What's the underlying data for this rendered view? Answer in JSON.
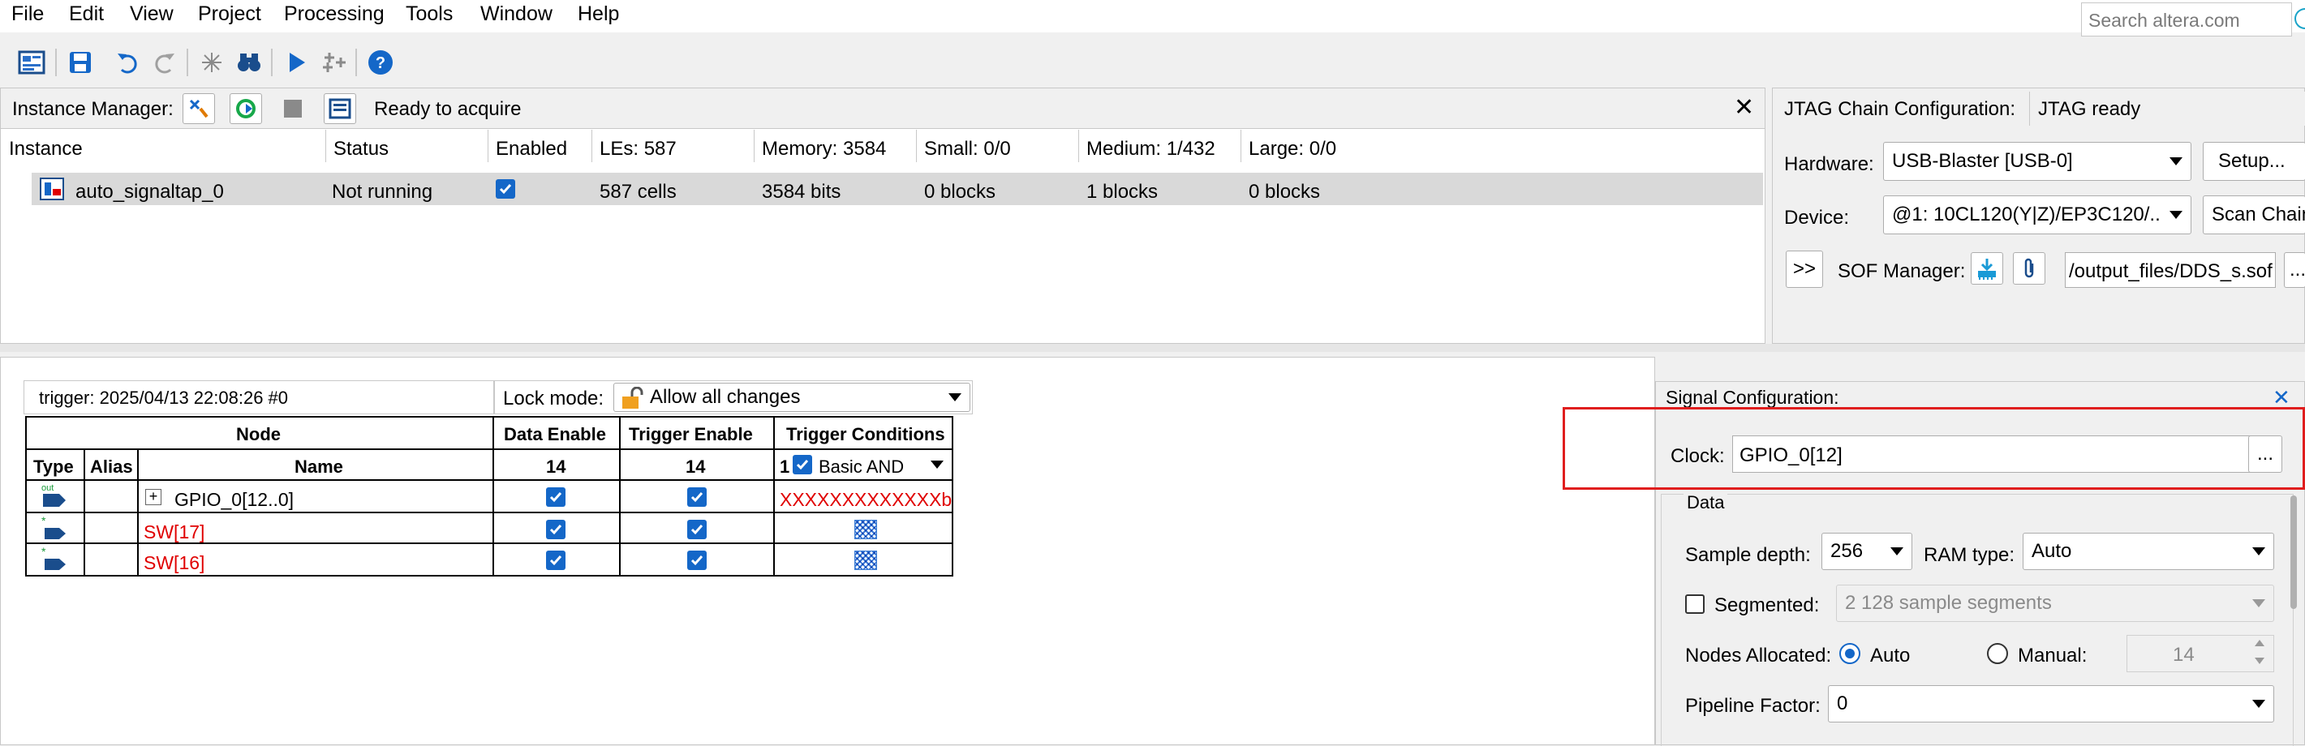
{
  "menu": {
    "items": [
      "File",
      "Edit",
      "View",
      "Project",
      "Processing",
      "Tools",
      "Window",
      "Help"
    ],
    "search_placeholder": "Search altera.com"
  },
  "toolbar": {
    "icons": [
      "signaltap-icon",
      "save-icon",
      "undo-icon",
      "redo-icon",
      "autorun-icon",
      "find-icon",
      "run-icon",
      "stop-analysis-icon",
      "help-icon"
    ]
  },
  "instance_manager": {
    "label": "Instance Manager:",
    "status": "Ready to acquire",
    "columns": [
      "Instance",
      "Status",
      "Enabled",
      "LEs: 587",
      "Memory: 3584",
      "Small: 0/0",
      "Medium: 1/432",
      "Large: 0/0"
    ],
    "row": {
      "instance": "auto_signaltap_0",
      "status": "Not running",
      "enabled": true,
      "les": "587 cells",
      "memory": "3584 bits",
      "small": "0 blocks",
      "medium": "1 blocks",
      "large": "0 blocks"
    }
  },
  "jtag": {
    "label": "JTAG Chain Configuration:",
    "status": "JTAG ready",
    "hardware_label": "Hardware:",
    "hardware_value": "USB-Blaster [USB-0]",
    "setup_button": "Setup...",
    "device_label": "Device:",
    "device_value": "@1: 10CL120(Y|Z)/EP3C120/..",
    "scan_chain_button": "Scan Chain",
    "expand_button": ">>",
    "sof_label": "SOF Manager:",
    "sof_value": "/output_files/DDS_s.sof",
    "browse_button": "..."
  },
  "signal_panel": {
    "trigger_label": "trigger: 2025/04/13 22:08:26  #0",
    "lock_mode_label": "Lock mode:",
    "lock_mode_value": "Allow all changes",
    "headers": {
      "node": "Node",
      "data_enable": "Data Enable",
      "trigger_enable": "Trigger Enable",
      "trigger_conditions": "Trigger Conditions",
      "type": "Type",
      "alias": "Alias",
      "name": "Name",
      "data_enable_count": "14",
      "trigger_enable_count": "14",
      "trigger_cond_prefix": "1",
      "trigger_cond_value": "Basic AND"
    },
    "rows": [
      {
        "name": "GPIO_0[12..0]",
        "trigger": "XXXXXXXXXXXXXb",
        "expand": "+"
      },
      {
        "name": "SW[17]"
      },
      {
        "name": "SW[16]"
      }
    ]
  },
  "signal_config": {
    "title": "Signal Configuration:",
    "clock_label": "Clock:",
    "clock_value": "GPIO_0[12]",
    "clock_browse": "...",
    "data_group": "Data",
    "sample_depth_label": "Sample depth:",
    "sample_depth_value": "256",
    "ram_type_label": "RAM type:",
    "ram_type_value": "Auto",
    "segmented_label": "Segmented:",
    "segmented_value": "2  128 sample segments",
    "nodes_allocated_label": "Nodes Allocated:",
    "auto_label": "Auto",
    "manual_label": "Manual:",
    "manual_value": "14",
    "pipeline_label": "Pipeline Factor:",
    "pipeline_value": "0"
  },
  "colors": {
    "accent": "#1467c8",
    "highlight": "#e00000",
    "selected_row": "#d9d9d9"
  }
}
